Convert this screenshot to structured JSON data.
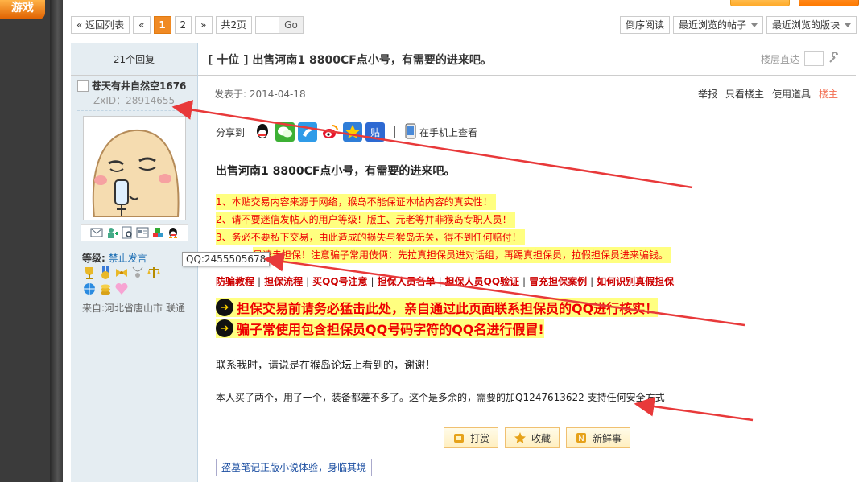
{
  "brand": {
    "text": "游戏"
  },
  "pager": {
    "back": "« 返回列表",
    "prev": "«",
    "pages": [
      "1",
      "2"
    ],
    "next": "»",
    "total": "共2页",
    "go": "Go"
  },
  "tools": {
    "reverse": "倒序阅读",
    "recent_posts": "最近浏览的帖子",
    "recent_boards": "最近浏览的版块"
  },
  "thread": {
    "replies": "21个回复",
    "title": "[ 十位 ] 出售河南1  8800CF点小号，有需要的进来吧。",
    "floor_jump": "楼层直达"
  },
  "author": {
    "name": "苍天有井自然空1676",
    "zxid": "ZxID：28914655",
    "level_label": "等级:",
    "level_value": "禁止发言",
    "from": "来自:河北省唐山市 联通",
    "tooltip": "QQ:2455505678"
  },
  "post": {
    "date": "发表于: 2014-04-18",
    "report": "举报",
    "only_author": "只看楼主",
    "use_tool": "使用道具",
    "louzhu": "楼主",
    "share_label": "分享到",
    "phone_view": "在手机上查看",
    "heading": "出售河南1  8800CF点小号，有需要的进来吧。",
    "notices": [
      "1、本贴交易内容来源于网络，猴岛不能保证本帖内容的真实性！",
      "2、请不要迷信发帖人的用户等级！版主、元老等并非猴岛专职人员！",
      "3、务必不要私下交易，由此造成的损失与猴岛无关，得不到任何赔付！",
      "易请走担保！注意骗子常用伎俩：先拉真担保员进对话组，再踢真担保员，拉假担保员进来骗钱。"
    ],
    "links": [
      "防骗教程",
      "担保流程",
      "买QQ号注意",
      "担保人员名单",
      "担保人员QQ验证",
      "冒充担保案例",
      "如何识别真假担保"
    ],
    "big1": "担保交易前请务必猛击此处，亲自通过此页面联系担保员的QQ进行核实！",
    "big2": "骗子常使用包含担保员QQ号码字符的QQ名进行假冒!",
    "contact": "联系我时，请说是在猴岛论坛上看到的，谢谢！",
    "body": "本人买了两个，用了一个，装备都差不多了。这个是多余的，需要的加Q1247613622 支持任何安全方式",
    "reward": "打赏",
    "favorite": "收藏",
    "fresh": "新鲜事",
    "ad": "盗墓笔记正版小说体验，身临其境"
  },
  "colors": {
    "accent": "#f08a24",
    "notice_bg": "#ffff80",
    "notice_text": "#e00000",
    "arrow": "#e8393a",
    "sidebar_bg": "#e5edf2"
  }
}
